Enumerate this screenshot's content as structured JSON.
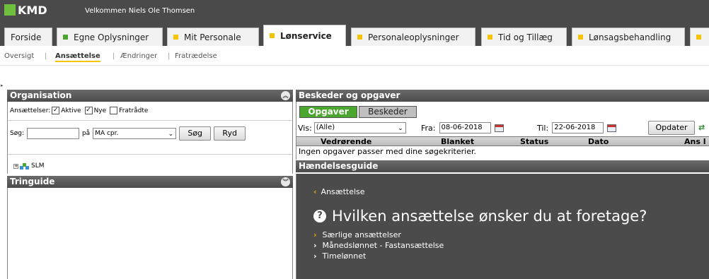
{
  "header": {
    "logo_text": "KMD",
    "welcome": "Velkommen Niels Ole Thomsen",
    "brand_color": "#6fbe3d"
  },
  "tabs": [
    {
      "label": "Forside",
      "icon": null
    },
    {
      "label": "Egne Oplysninger",
      "icon": "green-square"
    },
    {
      "label": "Mit Personale",
      "icon": "yellow-square"
    },
    {
      "label": "Lønservice",
      "icon": "yellow-square",
      "active": true
    },
    {
      "label": "Personaleoplysninger",
      "icon": "yellow-square"
    },
    {
      "label": "Tid og Tillæg",
      "icon": "yellow-square"
    },
    {
      "label": "Lønsagsbehandling",
      "icon": "yellow-square"
    }
  ],
  "subnav": [
    {
      "label": "Oversigt"
    },
    {
      "label": "Ansættelse",
      "active": true
    },
    {
      "label": "Ændringer"
    },
    {
      "label": "Fratrædelse"
    }
  ],
  "organisation": {
    "title": "Organisation",
    "employees_label": "Ansættelser:",
    "filters": [
      {
        "label": "Aktive",
        "checked": true
      },
      {
        "label": "Nye",
        "checked": true
      },
      {
        "label": "Fratrådte",
        "checked": false
      }
    ],
    "search_label": "Søg:",
    "search_value": "",
    "on_label": "på",
    "search_field_selected": "MA cpr.",
    "search_button": "Søg",
    "clear_button": "Ryd",
    "tree_root": "SLM"
  },
  "tringuide": {
    "title": "Tringuide"
  },
  "messages": {
    "title": "Beskeder og opgaver",
    "tab_tasks": "Opgaver",
    "tab_messages": "Beskeder",
    "show_label": "Vis:",
    "show_value": "(Alle)",
    "from_label": "Fra:",
    "from_date": "08-06-2018",
    "to_label": "Til:",
    "to_date": "22-06-2018",
    "update_button": "Opdater",
    "columns": [
      "Vedrørende",
      "Blanket",
      "Status",
      "Dato",
      "Ans l"
    ],
    "empty_message": "Ingen opgaver passer med dine søgekriterier."
  },
  "guide": {
    "title": "Hændelsesguide",
    "breadcrumb": "Ansættelse",
    "question": "Hvilken ansættelse ønsker du at foretage?",
    "options": [
      "Særlige ansættelser",
      "Månedslønnet - Fastansættelse",
      "Timelønnet"
    ]
  }
}
